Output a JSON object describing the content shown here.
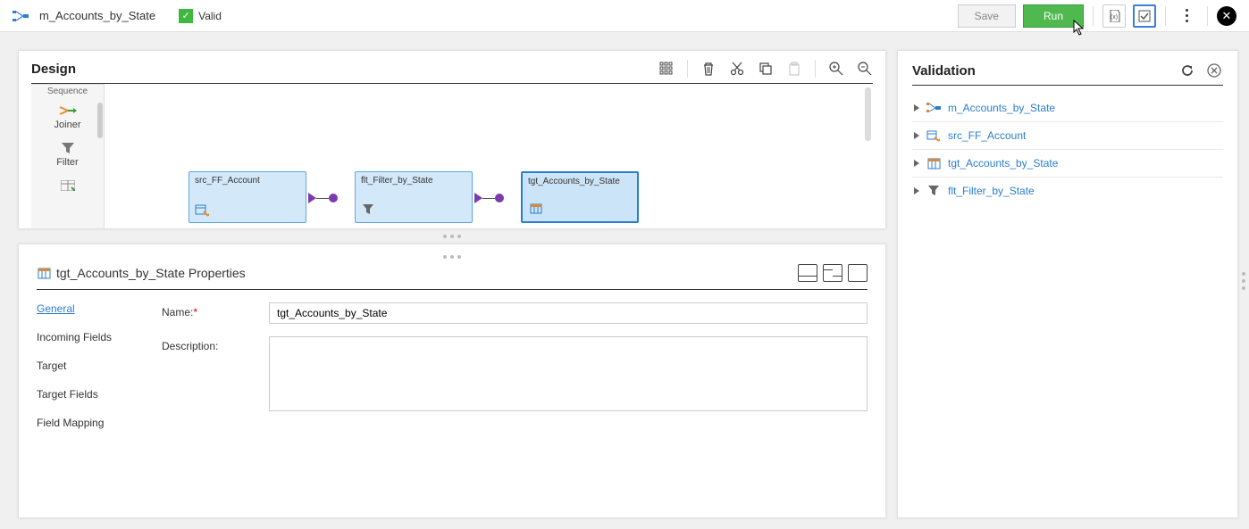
{
  "header": {
    "title": "m_Accounts_by_State",
    "valid_label": "Valid",
    "save_label": "Save",
    "run_label": "Run"
  },
  "design": {
    "title": "Design",
    "palette": {
      "heading": "Sequence",
      "items": [
        {
          "label": "Joiner"
        },
        {
          "label": "Filter"
        }
      ]
    },
    "nodes": {
      "src": "src_FF_Account",
      "flt": "flt_Filter_by_State",
      "tgt": "tgt_Accounts_by_State"
    }
  },
  "properties": {
    "title": "tgt_Accounts_by_State Properties",
    "tabs": {
      "general": "General",
      "incoming": "Incoming Fields",
      "target": "Target",
      "target_fields": "Target Fields",
      "field_mapping": "Field Mapping"
    },
    "form": {
      "name_label": "Name:",
      "desc_label": "Description:",
      "name_value": "tgt_Accounts_by_State",
      "desc_value": ""
    }
  },
  "validation": {
    "title": "Validation",
    "items": [
      "m_Accounts_by_State",
      "src_FF_Account",
      "tgt_Accounts_by_State",
      "flt_Filter_by_State"
    ]
  }
}
